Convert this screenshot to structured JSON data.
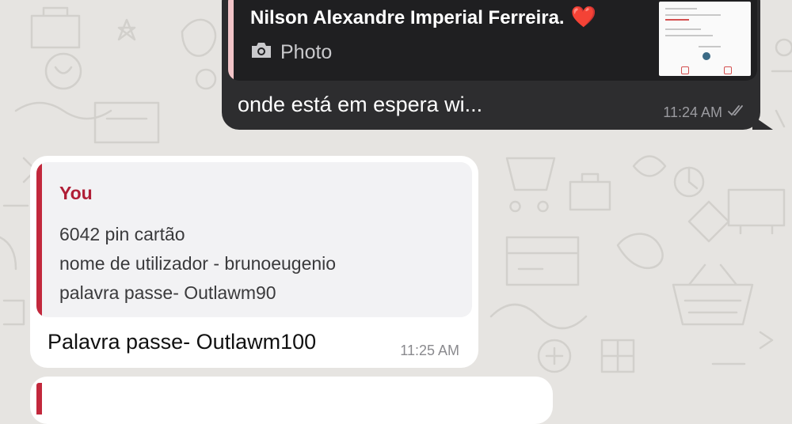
{
  "outgoing_message": {
    "reply_quote": {
      "author": "Nilson Alexandre Imperial Ferreira.",
      "reaction": "❤️",
      "media_icon": "camera-icon",
      "media_label": "Photo"
    },
    "text": "onde está em espera wi...",
    "time": "11:24 AM",
    "status_icon": "double-check-icon"
  },
  "incoming_message": {
    "reply_quote": {
      "author": "You",
      "lines": [
        "6042 pin cartão",
        "nome de utilizador - brunoeugenio",
        "palavra passe- Outlawm90"
      ]
    },
    "text": "Palavra passe- Outlawm100",
    "time": "11:25 AM"
  },
  "colors": {
    "wallpaper": "#e6e4e1",
    "outgoing_bubble": "#2d2d2f",
    "incoming_bubble": "#ffffff",
    "quote_bar_light": "#c2283c",
    "quote_bar_dark": "#f2c4c8"
  }
}
